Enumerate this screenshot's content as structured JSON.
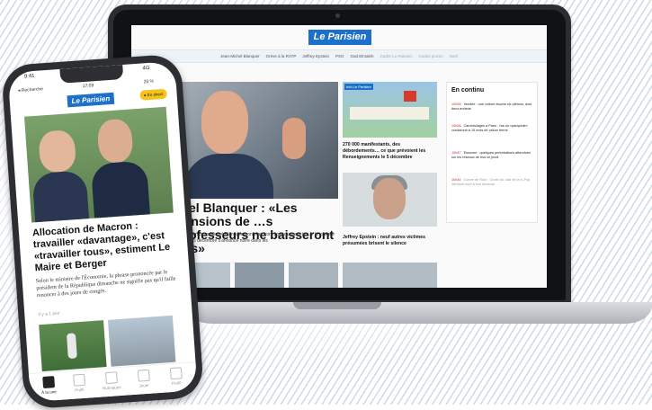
{
  "laptop": {
    "logo": "Le Parisien",
    "nav": [
      "Jean-Michel Blanquer",
      "Grève à la RATP",
      "Jeffrey Epstein",
      "PSG",
      "Gad Elmaleh",
      "Cadre Le Parisien",
      "Codes promo",
      "Noël"
    ],
    "hero_title": "…el Blanquer : «Les pensions de …s professeurs ne baisseront pas»",
    "hero_text": "…ducation Jean-Michel Blanquer monte au front pour rassurer les … la journée de jeudi 5 décembre s'annonce noire dans les",
    "protest_tag": "Info Le Parisien",
    "side_caption_1": "270 000 manifestants, des débordements… ce que prévoient les Renseignements le 5 décembre",
    "side_caption_2": "Jeffrey Epstein : neuf autres victimes présumées brisent le silence",
    "en_continu": {
      "title": "En continu",
      "items": [
        {
          "time": "10h59",
          "text": "Vendée : une voiture fauche six piétons, dont deux enfants"
        },
        {
          "time": "10h56",
          "text": "Cambriolages à Paris : l'as du «parapluie» condamné à 15 mois de prison ferme"
        },
        {
          "time": "10h47",
          "text": "Essonne : quelques perturbations attendues sur les réseaux de bus ce jeudi"
        },
        {
          "time": "10h44",
          "text": "Contre de Rouf : Chute du, star de la K-Pop, retrouvé mort à son domicile"
        }
      ]
    }
  },
  "phone": {
    "time": "9:41",
    "signal": "4G",
    "back": "◂ Recherche",
    "clock": "17:09",
    "battery": "28 %",
    "logo": "Le Parisien",
    "direct": "● En direct",
    "title": "Allocation de Macron : travailler «davantage», c'est «travailler tous», estiment Le Maire et Berger",
    "text": "Selon le ministre de l'Économie, la phrase prononcée par le président de la République dimanche ne signifie pas qu'il faille renoncer à des jours de congés.",
    "timestamp": "Il y a 1 jour",
    "tabs": [
      "À la une",
      "Profil",
      "Rubriques",
      "Jouer",
      "Profil"
    ]
  }
}
